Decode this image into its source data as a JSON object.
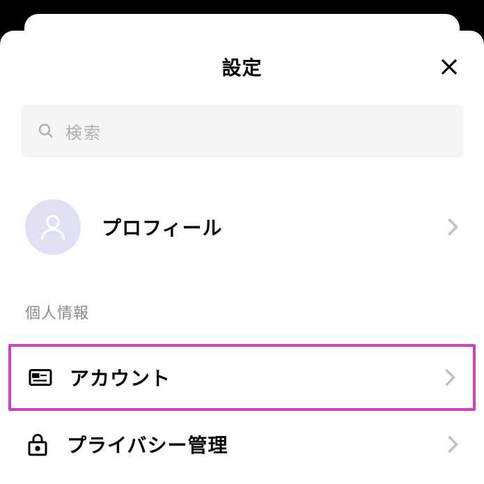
{
  "header": {
    "title": "設定"
  },
  "search": {
    "placeholder": "検索"
  },
  "profile": {
    "label": "プロフィール"
  },
  "section": {
    "title": "個人情報"
  },
  "items": {
    "account": {
      "label": "アカウント"
    },
    "privacy": {
      "label": "プライバシー管理"
    }
  }
}
